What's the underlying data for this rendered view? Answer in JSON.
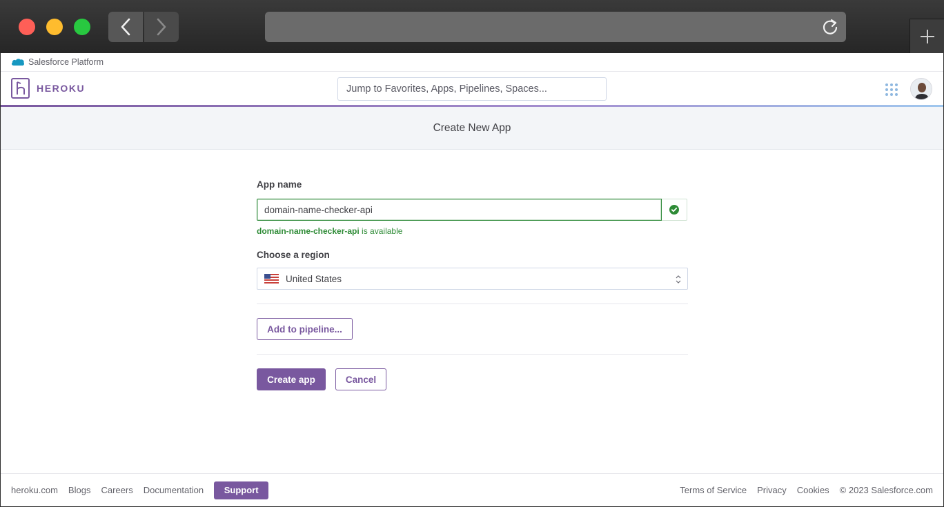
{
  "salesforce_bar": {
    "label": "Salesforce Platform"
  },
  "topnav": {
    "logo_text": "HEROKU",
    "search_placeholder": "Jump to Favorites, Apps, Pipelines, Spaces..."
  },
  "subheader": {
    "title": "Create New App"
  },
  "form": {
    "app_name_label": "App name",
    "app_name_value": "domain-name-checker-api",
    "availability_name": "domain-name-checker-api",
    "availability_suffix": " is available",
    "region_label": "Choose a region",
    "region_value": "United States",
    "pipeline_button": "Add to pipeline...",
    "create_button": "Create app",
    "cancel_button": "Cancel"
  },
  "footer": {
    "links_left": [
      "heroku.com",
      "Blogs",
      "Careers",
      "Documentation"
    ],
    "support": "Support",
    "links_right": [
      "Terms of Service",
      "Privacy",
      "Cookies"
    ],
    "copyright": "© 2023 Salesforce.com"
  },
  "colors": {
    "brand": "#79589f",
    "success": "#2e8b36"
  }
}
